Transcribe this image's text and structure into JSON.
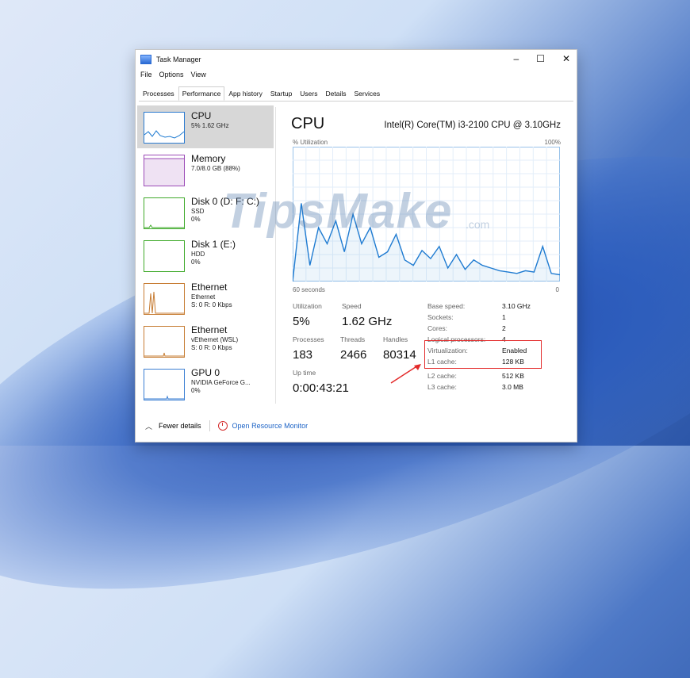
{
  "window": {
    "title": "Task Manager",
    "controls": {
      "minimize": "–",
      "maximize": "☐",
      "close": "✕"
    }
  },
  "menu": {
    "items": [
      "File",
      "Options",
      "View"
    ]
  },
  "tabs": [
    "Processes",
    "Performance",
    "App history",
    "Startup",
    "Users",
    "Details",
    "Services"
  ],
  "sidebar": {
    "items": [
      {
        "name": "CPU",
        "line1": "5% 1.62 GHz"
      },
      {
        "name": "Memory",
        "line1": "7.0/8.0 GB (88%)"
      },
      {
        "name": "Disk 0 (D: F: C:)",
        "line1": "SSD",
        "line2": "0%"
      },
      {
        "name": "Disk 1 (E:)",
        "line1": "HDD",
        "line2": "0%"
      },
      {
        "name": "Ethernet",
        "line1": "Ethernet",
        "line2": "S: 0 R: 0 Kbps"
      },
      {
        "name": "Ethernet",
        "line1": "vEthernet (WSL)",
        "line2": "S: 0 R: 0 Kbps"
      },
      {
        "name": "GPU 0",
        "line1": "NVIDIA GeForce G...",
        "line2": "0%"
      }
    ]
  },
  "main": {
    "title": "CPU",
    "model": "Intel(R) Core(TM) i3-2100 CPU @ 3.10GHz",
    "graph": {
      "y_label": "% Utilization",
      "y_max_label": "100%",
      "x_left_label": "60 seconds",
      "x_right_label": "0",
      "series": [
        0,
        58,
        12,
        40,
        28,
        45,
        22,
        50,
        28,
        40,
        18,
        22,
        35,
        16,
        12,
        23,
        17,
        26,
        10,
        20,
        9,
        16,
        12,
        10,
        8,
        7,
        6,
        8,
        7,
        26,
        6,
        5
      ]
    },
    "stats": {
      "utilization_label": "Utilization",
      "utilization_value": "5%",
      "speed_label": "Speed",
      "speed_value": "1.62 GHz",
      "processes_label": "Processes",
      "processes_value": "183",
      "threads_label": "Threads",
      "threads_value": "2466",
      "handles_label": "Handles",
      "handles_value": "80314",
      "uptime_label": "Up time",
      "uptime_value": "0:00:43:21"
    },
    "specs": {
      "base_speed_label": "Base speed:",
      "base_speed_value": "3.10 GHz",
      "sockets_label": "Sockets:",
      "sockets_value": "1",
      "cores_label": "Cores:",
      "cores_value": "2",
      "logical_label": "Logical processors:",
      "logical_value": "4",
      "virtualization_label": "Virtualization:",
      "virtualization_value": "Enabled",
      "l1_label": "L1 cache:",
      "l1_value": "128 KB",
      "l2_label": "L2 cache:",
      "l2_value": "512 KB",
      "l3_label": "L3 cache:",
      "l3_value": "3.0 MB"
    }
  },
  "footer": {
    "fewer_details": "Fewer details",
    "open_resource_monitor": "Open Resource Monitor"
  },
  "watermark": {
    "brand": "TipsMake",
    "suffix": ".com"
  },
  "colors": {
    "cpu_line": "#1f7bd1",
    "highlight": "#e32a2a"
  }
}
